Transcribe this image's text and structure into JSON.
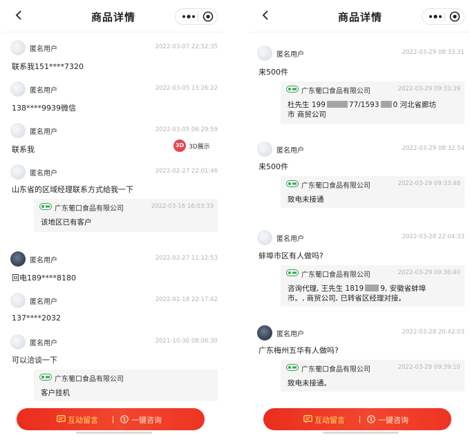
{
  "left": {
    "title": "商品详情",
    "badge": {
      "circle": "3D",
      "label": "3D展示"
    },
    "items": [
      {
        "user": "匿名用户",
        "time": "2022-03-07 22:52:35",
        "text": "联系我151****7320"
      },
      {
        "user": "匿名用户",
        "time": "2022-03-05 13:26:22",
        "text": "138****9939微信"
      },
      {
        "user": "匿名用户",
        "time": "2022-03-05 06:29:59",
        "text": "联系我"
      },
      {
        "user": "匿名用户",
        "time": "2022-02-27 22:01:46",
        "text": "山东省的区域经理联系方式给我一下",
        "reply": {
          "shop": "广东葡口食品有限公司",
          "time": "2022-03-16 16:03:33",
          "text": "该地区已有客户"
        }
      },
      {
        "user": "匿名用户",
        "time": "2022-02-27 11:12:53",
        "text": "回电189****8180"
      },
      {
        "user": "匿名用户",
        "time": "2022-02-18 22:17:42",
        "text": "137****2032"
      },
      {
        "user": "匿名用户",
        "time": "2021-10-30 08:06:30",
        "text": "可以洽谈一下",
        "reply": {
          "shop": "广东葡口食品有限公司",
          "time": "",
          "text": "客户挂机"
        }
      }
    ],
    "bottom": {
      "message_label": "互动留言",
      "consult_label": "一键咨询"
    }
  },
  "right": {
    "title": "商品详情",
    "items": [
      {
        "user": "匿名用户",
        "time": "2022-03-29 08:33:31",
        "text": "来500件",
        "reply": {
          "shop": "广东葡口食品有限公司",
          "time": "2022-03-29 09:33:39",
          "line1a": "杜先生 199",
          "line1b": "77/1593",
          "line1c": "0 河北省廊坊",
          "line2": "市 商贸公司"
        }
      },
      {
        "user": "匿名用户",
        "time": "2022-03-29 08:32:54",
        "text": "来500件",
        "reply": {
          "shop": "广东葡口食品有限公司",
          "time": "2022-03-29 09:33:48",
          "text": "致电未接通"
        }
      },
      {
        "user": "匿名用户",
        "time": "2022-03-28 22:04:33",
        "text": "蚌埠市区有人做吗?",
        "reply": {
          "shop": "广东葡口食品有限公司",
          "time": "2022-03-29 09:36:40",
          "line1a": "咨询代理, 王先生 1819",
          "line1b": "9, 安徽省蚌埠",
          "line2": "市。, 商贸公司, 已转省区经理对接。"
        }
      },
      {
        "user": "匿名用户",
        "time": "2022-03-28 20:42:03",
        "text": "广东梅州五华有人做吗?",
        "reply": {
          "shop": "广东葡口食品有限公司",
          "time": "2022-03-29 09:39:10",
          "text": "致电未接通。"
        }
      }
    ],
    "bottom": {
      "message_label": "互动留言",
      "consult_label": "一键咨询"
    }
  },
  "colors": {
    "accent": "#ee3424",
    "gold_text": "#ffe066",
    "reply_bg": "#f5f5f5",
    "time_gray": "#b3b3b3",
    "badge_red": "#e6464e",
    "shop_green": "#2fa84f"
  }
}
